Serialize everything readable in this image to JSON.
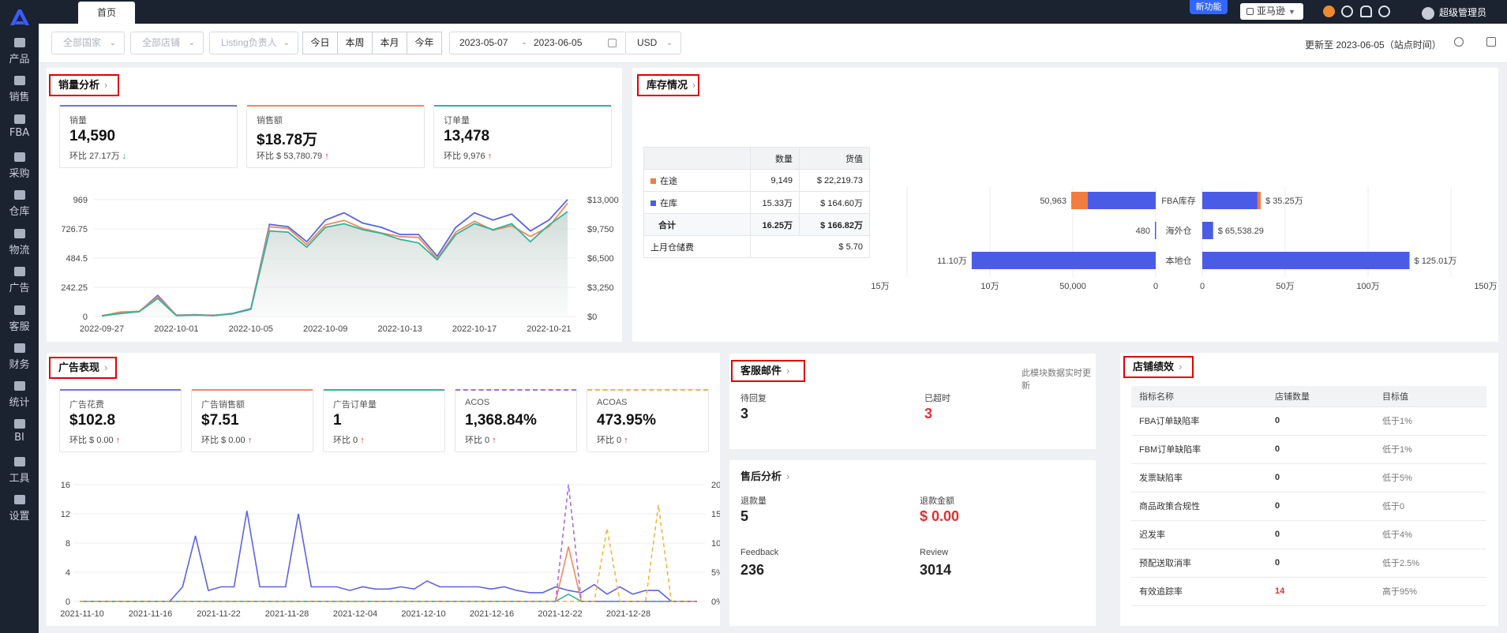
{
  "app": {
    "tab": "首页",
    "new_feature": "新功能",
    "marketplace": "亚马逊",
    "user": "超级管理员"
  },
  "nav": [
    "产品",
    "销售",
    "FBA",
    "采购",
    "仓库",
    "物流",
    "广告",
    "客服",
    "财务",
    "统计",
    "BI",
    "工具",
    "设置"
  ],
  "filters": {
    "country": "全部国家",
    "store": "全部店铺",
    "listing": "Listing负责人",
    "range_buttons": [
      "今日",
      "本周",
      "本月",
      "今年"
    ],
    "date_from": "2023-05-07",
    "date_sep": "-",
    "date_to": "2023-06-05",
    "currency": "USD",
    "updated": "更新至 2023-06-05（站点时间）"
  },
  "sales": {
    "title": "销量分析",
    "metrics": [
      {
        "label": "销量",
        "value": "14,590",
        "change": "环比 27.17万",
        "dir": "down",
        "color": "#6f72e6"
      },
      {
        "label": "销售额",
        "value": "$18.78万",
        "change": "环比 $ 53,780.79",
        "dir": "up",
        "color": "#f08a5d"
      },
      {
        "label": "订单量",
        "value": "13,478",
        "change": "环比 9,976",
        "dir": "up",
        "color": "#35b29a"
      }
    ]
  },
  "inventory": {
    "title": "库存情况",
    "table": {
      "headers": [
        "",
        "数量",
        "货值"
      ],
      "rows": [
        {
          "name": "在途",
          "qty": "9,149",
          "value": "$ 22,219.73",
          "dot": "#f37c3f"
        },
        {
          "name": "在库",
          "qty": "15.33万",
          "value": "$ 164.60万",
          "dot": "#4a5ce6"
        }
      ],
      "total": {
        "name": "合计",
        "qty": "16.25万",
        "value": "$ 166.82万"
      },
      "storage": {
        "name": "上月仓储费",
        "value": "$ 5.70"
      }
    }
  },
  "ads": {
    "title": "广告表现",
    "metrics": [
      {
        "label": "广告花费",
        "value": "$102.8",
        "change": "环比 $ 0.00",
        "dir": "up",
        "color": "#6f72e6"
      },
      {
        "label": "广告销售额",
        "value": "$7.51",
        "change": "环比 $ 0.00",
        "dir": "up",
        "color": "#f08a5d"
      },
      {
        "label": "广告订单量",
        "value": "1",
        "change": "环比 0",
        "dir": "up",
        "color": "#35b29a"
      },
      {
        "label": "ACOS",
        "value": "1,368.84%",
        "change": "环比 0",
        "dir": "up",
        "color": "#a86ae8"
      },
      {
        "label": "ACOAS",
        "value": "473.95%",
        "change": "环比 0",
        "dir": "up",
        "color": "#f2b441"
      }
    ]
  },
  "cs_mail": {
    "title": "客服邮件",
    "note": "此模块数据实时更新",
    "pending_label": "待回复",
    "pending": "3",
    "overdue_label": "已超时",
    "overdue": "3"
  },
  "after_sales": {
    "title": "售后分析",
    "refund_qty_label": "退款量",
    "refund_qty": "5",
    "refund_amt_label": "退款金额",
    "refund_amt": "$ 0.00",
    "feedback_label": "Feedback",
    "feedback": "236",
    "review_label": "Review",
    "review": "3014"
  },
  "store_perf": {
    "title": "店铺绩效",
    "headers": [
      "指标名称",
      "店铺数量",
      "目标值"
    ],
    "rows": [
      {
        "name": "FBA订单缺陷率",
        "count": "0",
        "target": "低于1%",
        "alert": false
      },
      {
        "name": "FBM订单缺陷率",
        "count": "0",
        "target": "低于1%",
        "alert": false
      },
      {
        "name": "发票缺陷率",
        "count": "0",
        "target": "低于5%",
        "alert": false
      },
      {
        "name": "商品政策合规性",
        "count": "0",
        "target": "低于0",
        "alert": false
      },
      {
        "name": "迟发率",
        "count": "0",
        "target": "低于4%",
        "alert": false
      },
      {
        "name": "预配送取消率",
        "count": "0",
        "target": "低于2.5%",
        "alert": false
      },
      {
        "name": "有效追踪率",
        "count": "14",
        "target": "高于95%",
        "alert": true
      }
    ]
  },
  "chart_data": [
    {
      "type": "line",
      "x": [
        "2022-09-27",
        "2022-09-28",
        "2022-09-29",
        "2022-09-30",
        "2022-10-01",
        "2022-10-02",
        "2022-10-03",
        "2022-10-04",
        "2022-10-05",
        "2022-10-06",
        "2022-10-07",
        "2022-10-08",
        "2022-10-09",
        "2022-10-10",
        "2022-10-11",
        "2022-10-12",
        "2022-10-13",
        "2022-10-14",
        "2022-10-15",
        "2022-10-16",
        "2022-10-17",
        "2022-10-18",
        "2022-10-19",
        "2022-10-20",
        "2022-10-21",
        "2022-10-22",
        "2022-10-23"
      ],
      "xticks": [
        "2022-09-27",
        "2022-10-01",
        "2022-10-05",
        "2022-10-09",
        "2022-10-13",
        "2022-10-17",
        "2022-10-21"
      ],
      "yticks_left": [
        "0",
        "242.25",
        "484.5",
        "726.75",
        "969"
      ],
      "yticks_right": [
        "$0",
        "$3,250",
        "$6,500",
        "$9,750",
        "$13,000"
      ],
      "ylim_left": [
        0,
        969
      ],
      "ylim_right": [
        0,
        13000
      ],
      "series": [
        {
          "axis": "left",
          "color": "#5b63e6",
          "values": [
            5,
            30,
            40,
            175,
            10,
            15,
            8,
            25,
            65,
            765,
            745,
            620,
            800,
            860,
            775,
            740,
            680,
            680,
            500,
            740,
            860,
            800,
            850,
            710,
            800,
            970
          ]
        },
        {
          "axis": "right",
          "color": "#f08a5d",
          "values": [
            80,
            500,
            580,
            2200,
            160,
            180,
            150,
            300,
            800,
            10000,
            9800,
            8000,
            10200,
            10700,
            9800,
            9300,
            8900,
            8800,
            6400,
            9400,
            10600,
            9600,
            10100,
            8900,
            10000,
            12600
          ]
        },
        {
          "axis": "left",
          "color": "#35b29a",
          "values": [
            5,
            25,
            40,
            150,
            8,
            12,
            8,
            22,
            60,
            710,
            700,
            575,
            740,
            770,
            720,
            690,
            640,
            610,
            470,
            680,
            770,
            720,
            770,
            620,
            760,
            870
          ]
        }
      ]
    },
    {
      "type": "bar",
      "categories": [
        "FBA库存",
        "海外仓",
        "本地仓"
      ],
      "left_series": {
        "labels": [
          "50,963",
          "480",
          "11.10万"
        ],
        "values": [
          50963,
          480,
          111000
        ],
        "in_transit": [
          10000,
          0,
          0
        ]
      },
      "right_series": {
        "labels": [
          "$ 35.25万",
          "$ 65,538.29",
          "$ 125.01万"
        ],
        "values": [
          352500,
          65538,
          1250100
        ],
        "in_transit": [
          20000,
          0,
          0
        ]
      },
      "left_ticks": [
        "15万",
        "10万",
        "50,000",
        "0"
      ],
      "right_ticks": [
        "0",
        "50万",
        "100万",
        "150万"
      ],
      "colors": {
        "in_stock": "#4a5ce6",
        "in_transit": "#f37c3f"
      }
    },
    {
      "type": "line",
      "xticks": [
        "2021-11-10",
        "2021-11-16",
        "2021-11-22",
        "2021-11-28",
        "2021-12-04",
        "2021-12-10",
        "2021-12-16",
        "2021-12-22",
        "2021-12-28"
      ],
      "yticks_left": [
        "0",
        "4",
        "8",
        "12",
        "16"
      ],
      "yticks_right": [
        "0%",
        "5%",
        "10%",
        "15%",
        "20%"
      ],
      "ylim_left": [
        0,
        16
      ],
      "ylim_right": [
        0,
        20
      ],
      "series": [
        {
          "axis": "left",
          "color": "#5b63e6",
          "dashed": false,
          "values": [
            0,
            0,
            0,
            0,
            0,
            0,
            0,
            0,
            2,
            9,
            1.5,
            2,
            2,
            12.4,
            2,
            2,
            2,
            12,
            2,
            2,
            2,
            1.5,
            2,
            1.7,
            1.7,
            2,
            1.7,
            2.8,
            2,
            2,
            2,
            2,
            1.7,
            2,
            1.5,
            1.2,
            1.2,
            2,
            1.5,
            1.2,
            2.3,
            1,
            2,
            1,
            1.5,
            1.5,
            0,
            0,
            0
          ]
        },
        {
          "axis": "left",
          "color": "#f08a5d",
          "dashed": false,
          "values": [
            0,
            0,
            0,
            0,
            0,
            0,
            0,
            0,
            0,
            0,
            0,
            0,
            0,
            0,
            0,
            0,
            0,
            0,
            0,
            0,
            0,
            0,
            0,
            0,
            0,
            0,
            0,
            0,
            0,
            0,
            0,
            0,
            0,
            0,
            0,
            0,
            0,
            0,
            7.5,
            0,
            0,
            0,
            0,
            0,
            0,
            0,
            0,
            0,
            0
          ]
        },
        {
          "axis": "left",
          "color": "#35b29a",
          "dashed": false,
          "values": [
            0,
            0,
            0,
            0,
            0,
            0,
            0,
            0,
            0,
            0,
            0,
            0,
            0,
            0,
            0,
            0,
            0,
            0,
            0,
            0,
            0,
            0,
            0,
            0,
            0,
            0,
            0,
            0,
            0,
            0,
            0,
            0,
            0,
            0,
            0,
            0,
            0,
            0,
            1,
            0,
            0,
            0,
            0,
            0,
            0,
            0,
            0,
            0,
            0
          ]
        },
        {
          "axis": "right",
          "color": "#a86ae8",
          "dashed": true,
          "values": [
            0,
            0,
            0,
            0,
            0,
            0,
            0,
            0,
            0,
            0,
            0,
            0,
            0,
            0,
            0,
            0,
            0,
            0,
            0,
            0,
            0,
            0,
            0,
            0,
            0,
            0,
            0,
            0,
            0,
            0,
            0,
            0,
            0,
            0,
            0,
            0,
            0,
            0,
            20,
            0,
            0,
            0,
            0,
            0,
            0,
            0,
            0,
            0,
            0
          ]
        },
        {
          "axis": "right",
          "color": "#f2b441",
          "dashed": true,
          "values": [
            0,
            0,
            0,
            0,
            0,
            0,
            0,
            0,
            0,
            0,
            0,
            0,
            0,
            0,
            0,
            0,
            0,
            0,
            0,
            0,
            0,
            0,
            0,
            0,
            0,
            0,
            0,
            0,
            0,
            0,
            0,
            0,
            0,
            0,
            0,
            0,
            0,
            0,
            0,
            0,
            0,
            12.5,
            0,
            0,
            0,
            16.5,
            0,
            0,
            0
          ]
        }
      ]
    }
  ]
}
